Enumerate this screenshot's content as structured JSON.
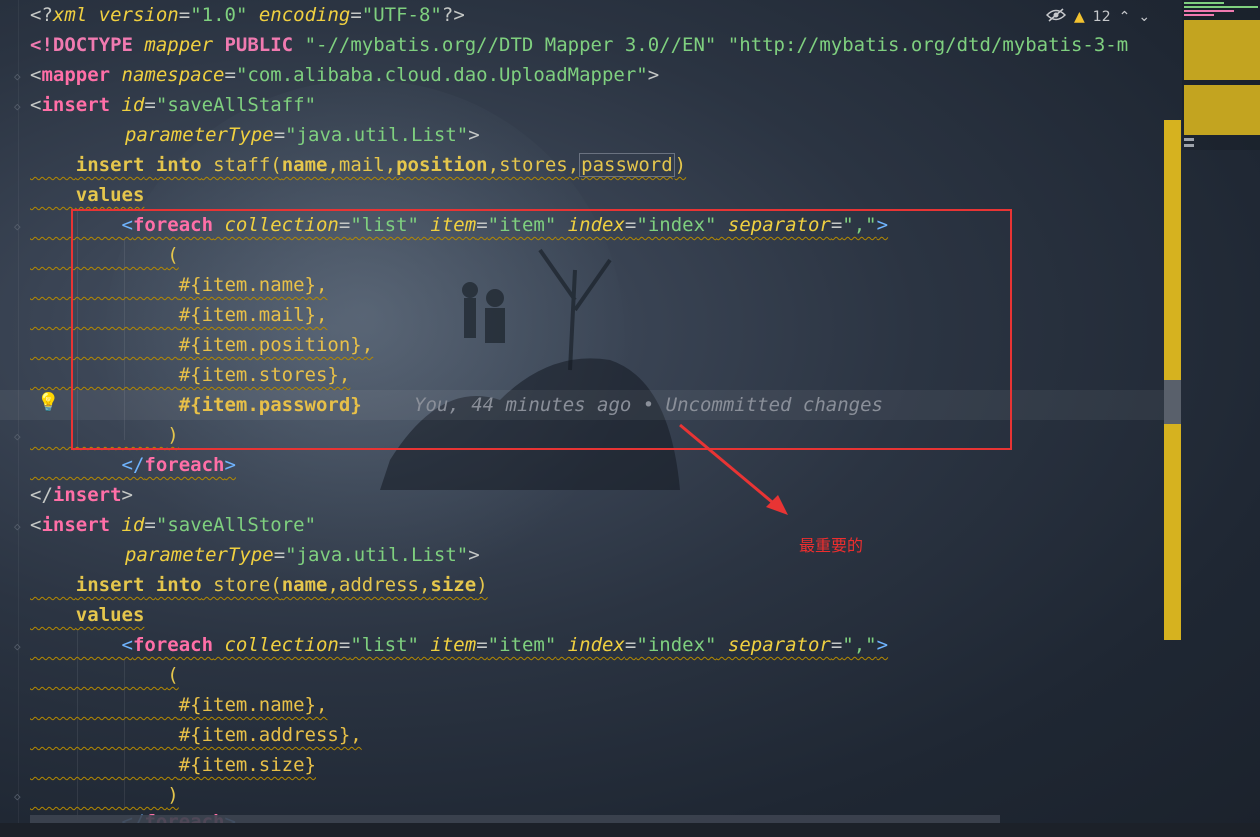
{
  "toolbar": {
    "warning_count": "12",
    "icons": [
      "eye-crossed-icon",
      "warning-icon",
      "chevron-up-icon",
      "chevron-down-icon"
    ]
  },
  "code": {
    "l1": {
      "a": "<?",
      "b": "xml",
      "c": " version",
      "d": "=",
      "e": "\"1.0\"",
      "f": " encoding",
      "g": "=",
      "h": "\"UTF-8\"",
      "i": "?>"
    },
    "l2": {
      "a": "<!",
      "b": "DOCTYPE",
      "c": " mapper ",
      "d": "PUBLIC",
      "e": " \"-//mybatis.org//DTD Mapper 3.0//EN\" \"http://mybatis.org/dtd/mybatis-3-m"
    },
    "l3": {
      "a": "<",
      "b": "mapper",
      "c": " namespace",
      "d": "=",
      "e": "\"com.alibaba.cloud.dao.UploadMapper\"",
      "f": ">"
    },
    "l4": {
      "a": "<",
      "b": "insert",
      "c": " id",
      "d": "=",
      "e": "\"saveAllStaff\""
    },
    "l5": {
      "c": "parameterType",
      "d": "=",
      "e": "\"java.util.List\"",
      "f": ">"
    },
    "l6": {
      "a": "insert",
      "b": " ",
      "c": "into",
      "d": " staff(",
      "e": "name",
      "f": ",mail,",
      "g": "position",
      "h": ",stores,",
      "i": "password",
      "j": ")"
    },
    "l7": {
      "a": "values"
    },
    "l8": {
      "a": "<",
      "b": "foreach",
      "c": " collection",
      "d": "=",
      "e": "\"list\"",
      "f": " item",
      "g": "=",
      "h": "\"item\"",
      "i": " index",
      "j": "=",
      "k": "\"index\"",
      "l": " separator",
      "m": "=",
      "n": "\",\"",
      "o": ">"
    },
    "l9": {
      "a": "("
    },
    "l10": {
      "a": "#{item.name},",
      "b": ""
    },
    "l11": {
      "a": "#{item.mail},"
    },
    "l12": {
      "a": "#{item.position},"
    },
    "l13": {
      "a": "#{item.stores},"
    },
    "l14": {
      "a": "#{item.password}"
    },
    "l15": {
      "a": ")"
    },
    "l16": {
      "a": "</",
      "b": "foreach",
      "c": ">"
    },
    "l17": {
      "a": "</",
      "b": "insert",
      "c": ">"
    },
    "l18": {
      "a": "<",
      "b": "insert",
      "c": " id",
      "d": "=",
      "e": "\"saveAllStore\""
    },
    "l19": {
      "c": "parameterType",
      "d": "=",
      "e": "\"java.util.List\"",
      "f": ">"
    },
    "l20": {
      "a": "insert",
      "b": " ",
      "c": "into",
      "d": " store(",
      "e": "name",
      "f": ",address,",
      "g": "size",
      "h": ")"
    },
    "l21": {
      "a": "values"
    },
    "l22": {
      "a": "<",
      "b": "foreach",
      "c": " collection",
      "d": "=",
      "e": "\"list\"",
      "f": " item",
      "g": "=",
      "h": "\"item\"",
      "i": " index",
      "j": "=",
      "k": "\"index\"",
      "l": " separator",
      "m": "=",
      "n": "\",\"",
      "o": ">"
    },
    "l23": {
      "a": "("
    },
    "l24": {
      "a": "#{item.name},"
    },
    "l25": {
      "a": "#{item.address},"
    },
    "l26": {
      "a": "#{item.size}"
    },
    "l27": {
      "a": ")"
    },
    "l28": {
      "a": "</",
      "b": "foreach",
      "c": ">"
    }
  },
  "blame": "You, 44 minutes ago • Uncommitted changes",
  "annotation": {
    "label": "最重要的",
    "color": "#e83434"
  },
  "colors": {
    "accent_warning": "#f2c230",
    "scrollbar_marker": "#d6b21f"
  }
}
